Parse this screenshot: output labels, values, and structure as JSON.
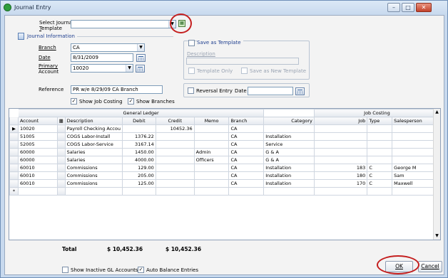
{
  "window": {
    "title": "Journal Entry",
    "minimize": "–",
    "maximize": "□",
    "close": "✕"
  },
  "template": {
    "label_line1": "Select Journal",
    "label_line2": "Template",
    "value": ""
  },
  "journal_info": {
    "title": "Journal Information"
  },
  "branch": {
    "label": "Branch",
    "value": "CA"
  },
  "date": {
    "label": "Date",
    "value": "8/31/2009"
  },
  "primary_account": {
    "label_line1": "Primary",
    "label_line2": "Account",
    "value": "10020"
  },
  "reference": {
    "label": "Reference",
    "value": "PR w/e 8/29/09 CA Branch"
  },
  "save_template": {
    "label": "Save as Template",
    "description_label": "Description",
    "template_only": "Template Only",
    "save_as_new": "Save as New Template"
  },
  "reversal": {
    "label": "Reversal Entry",
    "date_label": "Date",
    "date_value": ""
  },
  "options": {
    "show_job_costing": "Show Job Costing",
    "show_branches": "Show Branches"
  },
  "grid": {
    "group_gl": "General Ledger",
    "group_jc": "Job Costing",
    "columns": [
      "Account",
      "Description",
      "Debit",
      "Credit",
      "Memo",
      "Branch",
      "Category",
      "Job",
      "Type",
      "Salesperson"
    ],
    "rows": [
      [
        "10020",
        "Payroll Checking Accou",
        "",
        "10452.36",
        "",
        "CA",
        "",
        "",
        "",
        ""
      ],
      [
        "51005",
        "COGS Labor-Install",
        "1376.22",
        "",
        "",
        "CA",
        "Installation",
        "",
        "",
        ""
      ],
      [
        "52005",
        "COGS Labor-Service",
        "3167.14",
        "",
        "",
        "CA",
        "Service",
        "",
        "",
        ""
      ],
      [
        "60000",
        "Salaries",
        "1450.00",
        "",
        "Admin",
        "CA",
        "G & A",
        "",
        "",
        ""
      ],
      [
        "60000",
        "Salaries",
        "4000.00",
        "",
        "Officers",
        "CA",
        "G & A",
        "",
        "",
        ""
      ],
      [
        "60010",
        "Commissions",
        "129.00",
        "",
        "",
        "CA",
        "Installation",
        "183",
        "C",
        "George M"
      ],
      [
        "60010",
        "Commissions",
        "205.00",
        "",
        "",
        "CA",
        "Installation",
        "180",
        "C",
        "Sam"
      ],
      [
        "60010",
        "Commissions",
        "125.00",
        "",
        "",
        "CA",
        "Installation",
        "170",
        "C",
        "Maxwell"
      ]
    ],
    "current_row_marker": "▶",
    "new_row_marker": "*"
  },
  "totals": {
    "label": "Total",
    "debit": "$ 10,452.36",
    "credit": "$ 10,452.36"
  },
  "footer": {
    "show_inactive": "Show Inactive GL Accounts",
    "auto_balance": "Auto Balance Entries",
    "ok": "OK",
    "cancel": "Cancel"
  }
}
